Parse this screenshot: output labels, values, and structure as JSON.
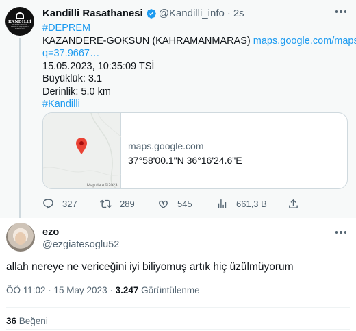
{
  "tweet1": {
    "author_name": "Kandilli Rasathanesi",
    "author_handle": "@Kandilli_info",
    "separator": "·",
    "time": "2s",
    "avatar_logo_text": "KANDİLLİ",
    "avatar_logo_sub": "RASATHANESİ VE DEPREM ARAŞTIRMA ENSTİTÜSÜ",
    "hashtag_top": "#DEPREM",
    "location_text": "KAZANDERE-GOKSUN (KAHRAMANMARAS)",
    "link_part1": "maps.google.com/maps?",
    "link_part2": "q=37.9667…",
    "datetime": "15.05.2023, 10:35:09 TSİ",
    "magnitude": "Büyüklük: 3.1",
    "depth": "Derinlik: 5.0 km",
    "hashtag_bottom": "#Kandilli",
    "card": {
      "domain": "maps.google.com",
      "coords": "37°58'00.1\"N 36°16'24.6\"E",
      "map_credit": "Map data ©2023"
    },
    "actions": {
      "replies": "327",
      "retweets": "289",
      "likes": "545",
      "views": "661,3 B"
    }
  },
  "tweet2": {
    "author_name": "ezo",
    "author_handle": "@ezgiatesoglu52",
    "text": "allah nereye ne vericeğini iyi biliyomuş artık hiç üzülmüyorum",
    "meta_time": "ÖÖ 11:02 · 15 May 2023 · ",
    "views_count": "3.247",
    "views_label": " Görüntülenme",
    "likes_count": "36",
    "likes_label": " Beğeni"
  },
  "colors": {
    "accent": "#1d9bf0",
    "secondary_text": "#536471",
    "primary_text": "#0f1419",
    "thread_bg": "#f7f9f9",
    "map_pin": "#ea4335"
  }
}
